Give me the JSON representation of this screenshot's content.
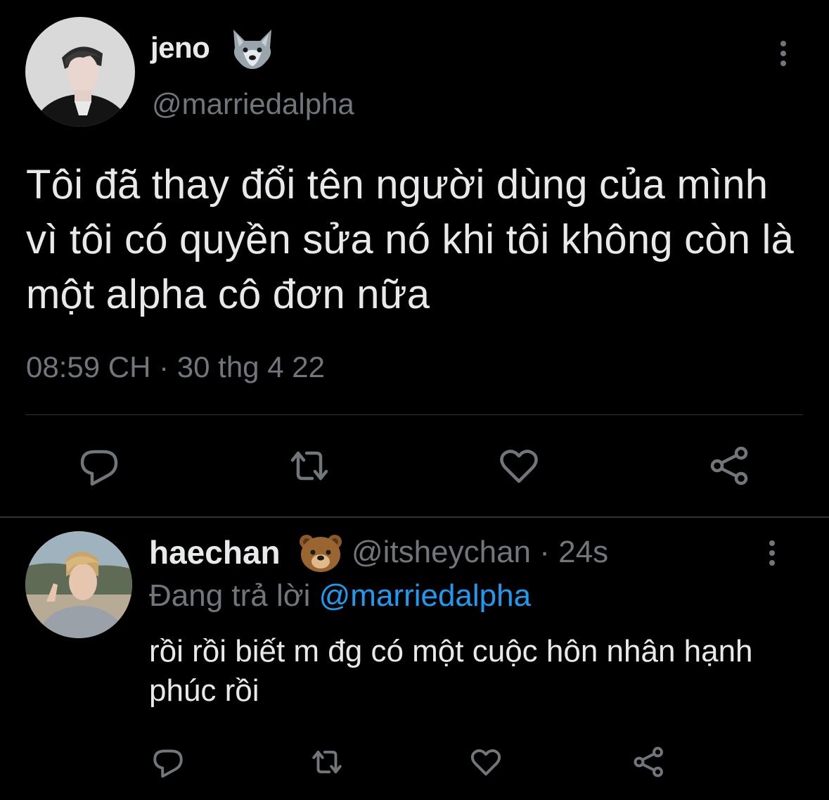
{
  "colors": {
    "background": "#000000",
    "primary_text": "#e7e9ea",
    "secondary_text": "#71767b",
    "link": "#1d9bf0",
    "icon": "#71767b",
    "divider": "#2f3336"
  },
  "main_tweet": {
    "display_name": "jeno",
    "name_emoji": "wolf-emoji",
    "handle": "@marriedalpha",
    "text": "Tôi đã thay đổi tên người dùng của mình vì tôi có quyền sửa nó khi tôi không còn là một alpha cô đơn nữa",
    "timestamp": "08:59 CH · 30 thg 4 22",
    "actions": [
      "reply-icon",
      "retweet-icon",
      "like-icon",
      "share-icon"
    ]
  },
  "reply": {
    "display_name": "haechan",
    "name_emoji": "bear-emoji",
    "handle_time": "@itsheychan · 24s",
    "replying_prefix": "Đang trả lời ",
    "replying_mention": "@marriedalpha",
    "text": "rồi rồi biết m đg có một cuộc hôn nhân hạnh phúc rồi",
    "actions": [
      "reply-icon",
      "retweet-icon",
      "like-icon",
      "share-icon"
    ]
  }
}
